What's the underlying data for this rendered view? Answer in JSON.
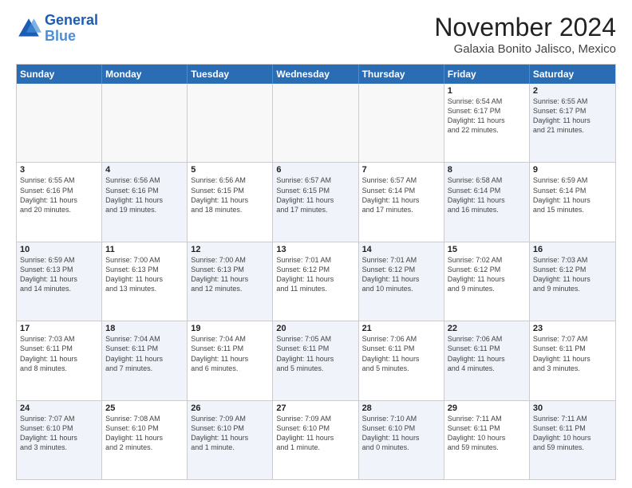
{
  "logo": {
    "line1": "General",
    "line2": "Blue"
  },
  "title": "November 2024",
  "subtitle": "Galaxia Bonito Jalisco, Mexico",
  "days": [
    "Sunday",
    "Monday",
    "Tuesday",
    "Wednesday",
    "Thursday",
    "Friday",
    "Saturday"
  ],
  "weeks": [
    [
      {
        "day": "",
        "info": "",
        "empty": true
      },
      {
        "day": "",
        "info": "",
        "empty": true
      },
      {
        "day": "",
        "info": "",
        "empty": true
      },
      {
        "day": "",
        "info": "",
        "empty": true
      },
      {
        "day": "",
        "info": "",
        "empty": true
      },
      {
        "day": "1",
        "info": "Sunrise: 6:54 AM\nSunset: 6:17 PM\nDaylight: 11 hours\nand 22 minutes."
      },
      {
        "day": "2",
        "info": "Sunrise: 6:55 AM\nSunset: 6:17 PM\nDaylight: 11 hours\nand 21 minutes.",
        "shaded": true
      }
    ],
    [
      {
        "day": "3",
        "info": "Sunrise: 6:55 AM\nSunset: 6:16 PM\nDaylight: 11 hours\nand 20 minutes."
      },
      {
        "day": "4",
        "info": "Sunrise: 6:56 AM\nSunset: 6:16 PM\nDaylight: 11 hours\nand 19 minutes.",
        "shaded": true
      },
      {
        "day": "5",
        "info": "Sunrise: 6:56 AM\nSunset: 6:15 PM\nDaylight: 11 hours\nand 18 minutes."
      },
      {
        "day": "6",
        "info": "Sunrise: 6:57 AM\nSunset: 6:15 PM\nDaylight: 11 hours\nand 17 minutes.",
        "shaded": true
      },
      {
        "day": "7",
        "info": "Sunrise: 6:57 AM\nSunset: 6:14 PM\nDaylight: 11 hours\nand 17 minutes."
      },
      {
        "day": "8",
        "info": "Sunrise: 6:58 AM\nSunset: 6:14 PM\nDaylight: 11 hours\nand 16 minutes.",
        "shaded": true
      },
      {
        "day": "9",
        "info": "Sunrise: 6:59 AM\nSunset: 6:14 PM\nDaylight: 11 hours\nand 15 minutes."
      }
    ],
    [
      {
        "day": "10",
        "info": "Sunrise: 6:59 AM\nSunset: 6:13 PM\nDaylight: 11 hours\nand 14 minutes.",
        "shaded": true
      },
      {
        "day": "11",
        "info": "Sunrise: 7:00 AM\nSunset: 6:13 PM\nDaylight: 11 hours\nand 13 minutes."
      },
      {
        "day": "12",
        "info": "Sunrise: 7:00 AM\nSunset: 6:13 PM\nDaylight: 11 hours\nand 12 minutes.",
        "shaded": true
      },
      {
        "day": "13",
        "info": "Sunrise: 7:01 AM\nSunset: 6:12 PM\nDaylight: 11 hours\nand 11 minutes."
      },
      {
        "day": "14",
        "info": "Sunrise: 7:01 AM\nSunset: 6:12 PM\nDaylight: 11 hours\nand 10 minutes.",
        "shaded": true
      },
      {
        "day": "15",
        "info": "Sunrise: 7:02 AM\nSunset: 6:12 PM\nDaylight: 11 hours\nand 9 minutes."
      },
      {
        "day": "16",
        "info": "Sunrise: 7:03 AM\nSunset: 6:12 PM\nDaylight: 11 hours\nand 9 minutes.",
        "shaded": true
      }
    ],
    [
      {
        "day": "17",
        "info": "Sunrise: 7:03 AM\nSunset: 6:11 PM\nDaylight: 11 hours\nand 8 minutes."
      },
      {
        "day": "18",
        "info": "Sunrise: 7:04 AM\nSunset: 6:11 PM\nDaylight: 11 hours\nand 7 minutes.",
        "shaded": true
      },
      {
        "day": "19",
        "info": "Sunrise: 7:04 AM\nSunset: 6:11 PM\nDaylight: 11 hours\nand 6 minutes."
      },
      {
        "day": "20",
        "info": "Sunrise: 7:05 AM\nSunset: 6:11 PM\nDaylight: 11 hours\nand 5 minutes.",
        "shaded": true
      },
      {
        "day": "21",
        "info": "Sunrise: 7:06 AM\nSunset: 6:11 PM\nDaylight: 11 hours\nand 5 minutes."
      },
      {
        "day": "22",
        "info": "Sunrise: 7:06 AM\nSunset: 6:11 PM\nDaylight: 11 hours\nand 4 minutes.",
        "shaded": true
      },
      {
        "day": "23",
        "info": "Sunrise: 7:07 AM\nSunset: 6:11 PM\nDaylight: 11 hours\nand 3 minutes."
      }
    ],
    [
      {
        "day": "24",
        "info": "Sunrise: 7:07 AM\nSunset: 6:10 PM\nDaylight: 11 hours\nand 3 minutes.",
        "shaded": true
      },
      {
        "day": "25",
        "info": "Sunrise: 7:08 AM\nSunset: 6:10 PM\nDaylight: 11 hours\nand 2 minutes."
      },
      {
        "day": "26",
        "info": "Sunrise: 7:09 AM\nSunset: 6:10 PM\nDaylight: 11 hours\nand 1 minute.",
        "shaded": true
      },
      {
        "day": "27",
        "info": "Sunrise: 7:09 AM\nSunset: 6:10 PM\nDaylight: 11 hours\nand 1 minute."
      },
      {
        "day": "28",
        "info": "Sunrise: 7:10 AM\nSunset: 6:10 PM\nDaylight: 11 hours\nand 0 minutes.",
        "shaded": true
      },
      {
        "day": "29",
        "info": "Sunrise: 7:11 AM\nSunset: 6:11 PM\nDaylight: 10 hours\nand 59 minutes."
      },
      {
        "day": "30",
        "info": "Sunrise: 7:11 AM\nSunset: 6:11 PM\nDaylight: 10 hours\nand 59 minutes.",
        "shaded": true
      }
    ]
  ]
}
